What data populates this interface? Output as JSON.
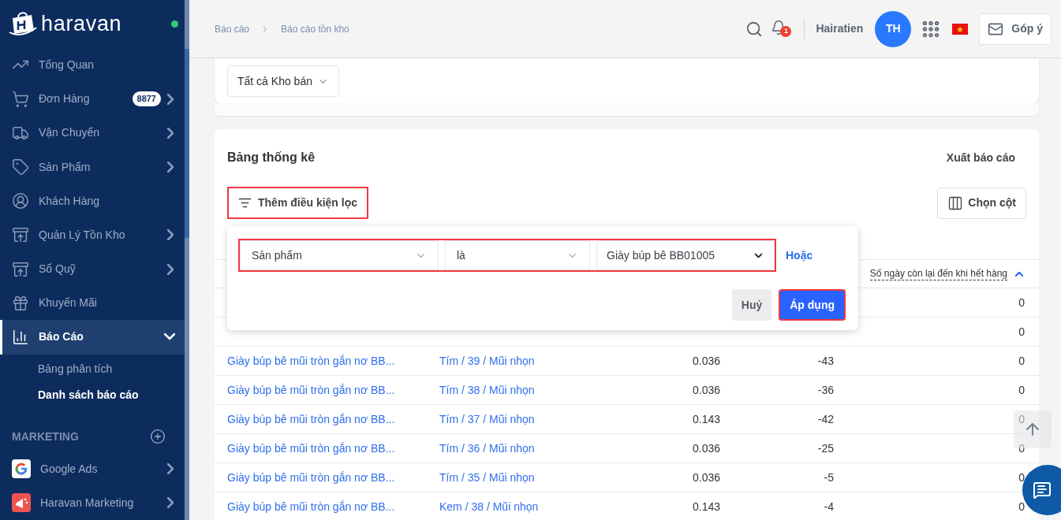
{
  "sidebar": {
    "logo": "haravan",
    "items": [
      {
        "label": "Tổng Quan",
        "expandable": false,
        "expanded": false,
        "selected": false
      },
      {
        "label": "Đơn Hàng",
        "badge": "8877",
        "expandable": true,
        "expanded": false,
        "selected": false
      },
      {
        "label": "Vận Chuyển",
        "expandable": true,
        "expanded": false,
        "selected": false
      },
      {
        "label": "Sản Phẩm",
        "expandable": true,
        "expanded": false,
        "selected": false
      },
      {
        "label": "Khách Hàng",
        "expandable": false,
        "expanded": false,
        "selected": false
      },
      {
        "label": "Quản Lý Tồn Kho",
        "expandable": true,
        "expanded": false,
        "selected": false
      },
      {
        "label": "Số Quỹ",
        "expandable": true,
        "expanded": false,
        "selected": false
      },
      {
        "label": "Khuyến Mãi",
        "expandable": false,
        "expanded": false,
        "selected": false
      },
      {
        "label": "Báo Cáo",
        "expandable": true,
        "expanded": true,
        "selected": true,
        "children": [
          {
            "label": "Bảng phân tích",
            "selected": false
          },
          {
            "label": "Danh sách báo cáo",
            "selected": true
          }
        ]
      }
    ],
    "section": {
      "title": "MARKETING",
      "items": [
        {
          "label": "Google Ads",
          "expandable": true
        },
        {
          "label": "Haravan Marketing",
          "expandable": true
        }
      ]
    }
  },
  "header": {
    "breadcrumb": [
      "Báo cáo",
      "Báo cáo tồn kho"
    ],
    "notification_count": "1",
    "user": "Hairatien",
    "avatar": "TH",
    "feedback": "Góp ý"
  },
  "warehouse_select": {
    "value": "Tất cả Kho bán"
  },
  "report": {
    "title": "Bảng thống kê",
    "export": "Xuất báo cáo",
    "filter_button": {
      "label": "Thêm điều kiện lọc",
      "highlighted": true
    },
    "columns_button": "Chọn cột",
    "filter_popover": {
      "conditions": [
        {
          "field": "Sản phẩm",
          "operator": "là",
          "value": "Giày búp bê BB01005",
          "highlighted": true
        }
      ],
      "or_link": "Hoặc",
      "cancel": "Huỷ",
      "apply": {
        "label": "Áp dụng",
        "highlighted": true
      }
    },
    "table": {
      "days_header": {
        "label": "Số ngày còn lại đến khi hết hàng",
        "ascending": true
      },
      "rows": [
        {
          "days": "0"
        },
        {
          "days": "0"
        },
        {
          "product": "Giày búp bê mũi tròn gắn nơ BB...",
          "variant": "Tím / 39 / Mũi nhọn",
          "column_3": "0.036",
          "column_4": "-43",
          "days": "0"
        },
        {
          "product": "Giày búp bê mũi tròn gắn nơ BB...",
          "variant": "Tím / 38 / Mũi nhọn",
          "column_3": "0.036",
          "column_4": "-36",
          "days": "0"
        },
        {
          "product": "Giày búp bê mũi tròn gắn nơ BB...",
          "variant": "Tím / 37 / Mũi nhọn",
          "column_3": "0.143",
          "column_4": "-42",
          "days": "0"
        },
        {
          "product": "Giày búp bê mũi tròn gắn nơ BB...",
          "variant": "Tím / 36 / Mũi nhọn",
          "column_3": "0.036",
          "column_4": "-25",
          "days": "0"
        },
        {
          "product": "Giày búp bê mũi tròn gắn nơ BB...",
          "variant": "Tím / 35 / Mũi nhọn",
          "column_3": "0.036",
          "column_4": "-5",
          "days": "0"
        },
        {
          "product": "Giày búp bê mũi tròn gắn nơ BB...",
          "variant": "Kem / 38 / Mũi nhọn",
          "column_3": "0.143",
          "column_4": "-4",
          "days": "0"
        }
      ]
    }
  }
}
